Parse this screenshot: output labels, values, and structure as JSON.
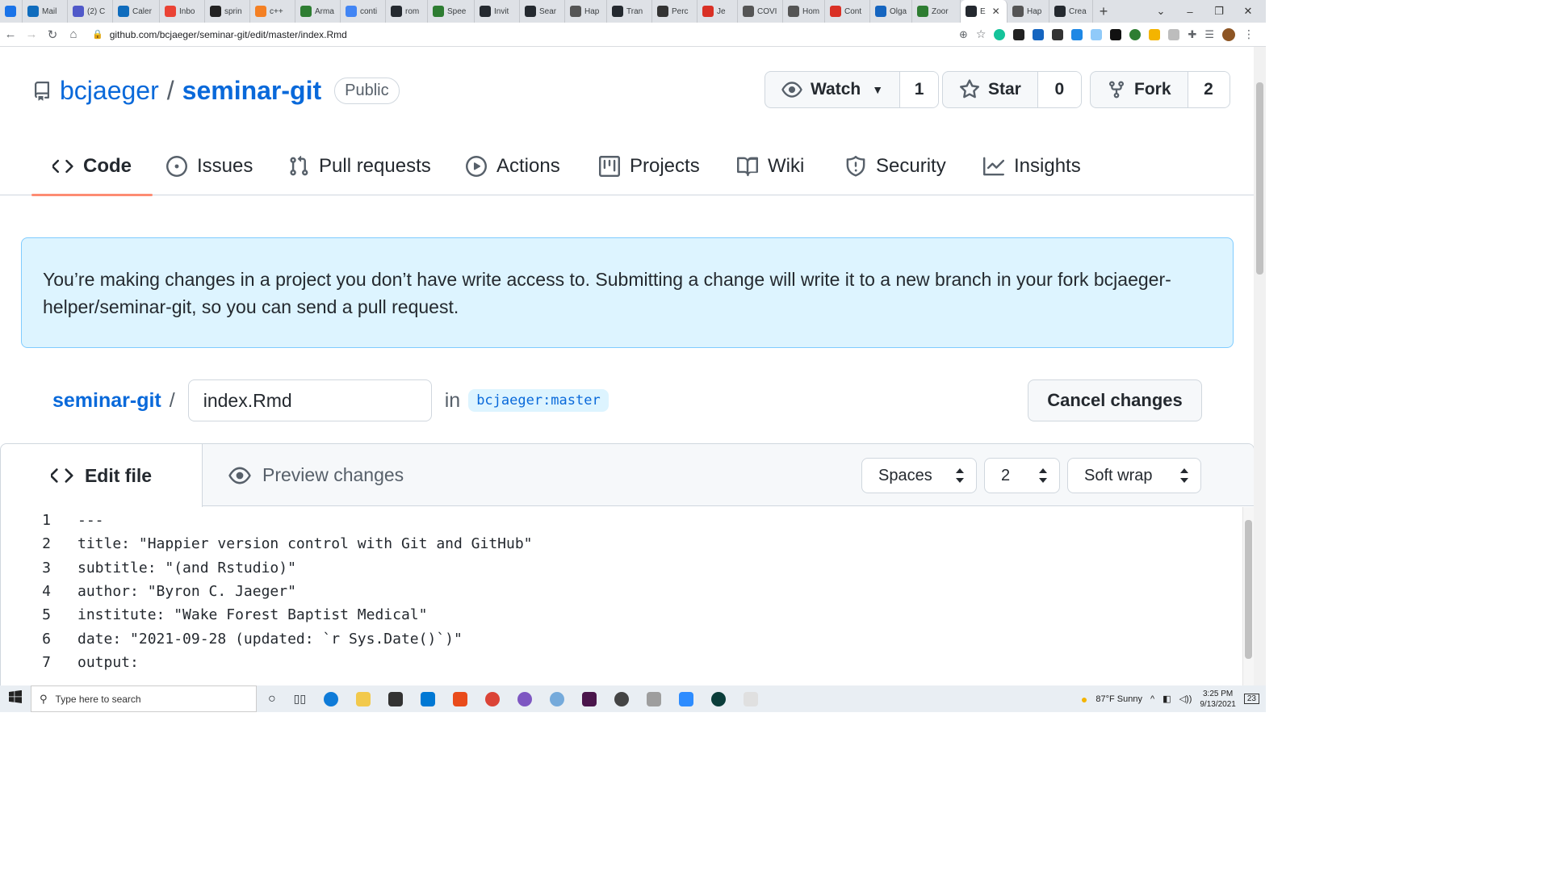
{
  "browser": {
    "tabs": [
      {
        "label": "",
        "color": "#1a73e8"
      },
      {
        "label": "Mail",
        "color": "#0f6cbd"
      },
      {
        "label": "(2) C",
        "color": "#5059c9"
      },
      {
        "label": "Caler",
        "color": "#0f6cbd"
      },
      {
        "label": "Inbo",
        "color": "#ea4335"
      },
      {
        "label": "sprin",
        "color": "#222222"
      },
      {
        "label": "c++",
        "color": "#f48024"
      },
      {
        "label": "Arma",
        "color": "#2e7d32"
      },
      {
        "label": "conti",
        "color": "#4285f4"
      },
      {
        "label": "rom",
        "color": "#24292f"
      },
      {
        "label": "Spee",
        "color": "#2e7d32"
      },
      {
        "label": "Invit",
        "color": "#24292f"
      },
      {
        "label": "Sear",
        "color": "#24292f"
      },
      {
        "label": "Hap",
        "color": "#555555"
      },
      {
        "label": "Tran",
        "color": "#24292f"
      },
      {
        "label": "Perc",
        "color": "#333333"
      },
      {
        "label": "Je",
        "color": "#d93025"
      },
      {
        "label": "COVI",
        "color": "#555555"
      },
      {
        "label": "Hom",
        "color": "#555555"
      },
      {
        "label": "Cont",
        "color": "#d93025"
      },
      {
        "label": "Olga",
        "color": "#1565c0"
      },
      {
        "label": "Zoor",
        "color": "#2e7d32"
      },
      {
        "label": "E",
        "color": "#24292f",
        "active": true
      },
      {
        "label": "Hap",
        "color": "#555555"
      },
      {
        "label": "Crea",
        "color": "#24292f"
      }
    ],
    "new_tab_glyph": "+",
    "url": "github.com/bcjaeger/seminar-git/edit/master/index.Rmd"
  },
  "repo": {
    "owner": "bcjaeger",
    "separator": "/",
    "name": "seminar-git",
    "visibility": "Public"
  },
  "actions": {
    "watch_label": "Watch",
    "watch_count": "1",
    "star_label": "Star",
    "star_count": "0",
    "fork_label": "Fork",
    "fork_count": "2"
  },
  "nav": {
    "code": "Code",
    "issues": "Issues",
    "pulls": "Pull requests",
    "actions": "Actions",
    "projects": "Projects",
    "wiki": "Wiki",
    "security": "Security",
    "insights": "Insights"
  },
  "flash": {
    "message": "You’re making changes in a project you don’t have write access to. Submitting a change will write it to a new branch in your fork bcjaeger-helper/seminar-git, so you can send a pull request."
  },
  "editbar": {
    "repo_link": "seminar-git",
    "separator": "/",
    "filename": "index.Rmd",
    "in_label": "in",
    "branch": "bcjaeger:master",
    "cancel_label": "Cancel changes"
  },
  "editor": {
    "edit_tab": "Edit file",
    "preview_tab": "Preview changes",
    "indent_mode": "Spaces",
    "indent_size": "2",
    "wrap_mode": "Soft wrap",
    "lines": [
      {
        "n": "1",
        "text": "---"
      },
      {
        "n": "2",
        "text": "title: \"Happier version control with Git and GitHub\""
      },
      {
        "n": "3",
        "text": "subtitle: \"(and Rstudio)\""
      },
      {
        "n": "4",
        "text": "author: \"Byron C. Jaeger\""
      },
      {
        "n": "5",
        "text": "institute: \"Wake Forest Baptist Medical\""
      },
      {
        "n": "6",
        "text": "date: \"2021-09-28 (updated: `r Sys.Date()`)\""
      },
      {
        "n": "7",
        "text": "output:"
      }
    ]
  },
  "taskbar": {
    "search_placeholder": "Type here to search",
    "weather": "87°F  Sunny",
    "time": "3:25 PM",
    "date": "9/13/2021",
    "notifications": "23"
  }
}
